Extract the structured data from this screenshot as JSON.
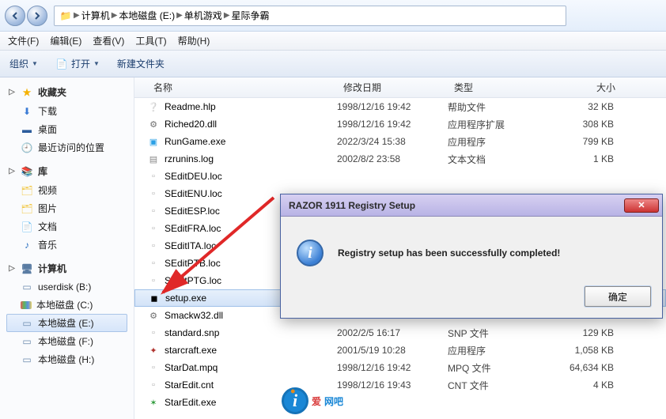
{
  "address": {
    "root_icon": "📁",
    "crumbs": [
      "计算机",
      "本地磁盘 (E:)",
      "单机游戏",
      "星际争霸"
    ]
  },
  "menus": [
    "文件(F)",
    "编辑(E)",
    "查看(V)",
    "工具(T)",
    "帮助(H)"
  ],
  "commands": {
    "organize": "组织",
    "open": "打开",
    "open_icon": "📄",
    "newfolder": "新建文件夹"
  },
  "sidebar": {
    "fav": {
      "label": "收藏夹",
      "icon": "★",
      "items": [
        {
          "label": "下载",
          "icon": "⬇",
          "cls": "ico-dl"
        },
        {
          "label": "桌面",
          "icon": "▬",
          "cls": "ico-desk"
        },
        {
          "label": "最近访问的位置",
          "icon": "🕘",
          "cls": "ico-recent"
        }
      ]
    },
    "lib": {
      "label": "库",
      "icon": "📚",
      "items": [
        {
          "label": "视频",
          "icon": "🗂",
          "cls": "ico-folder"
        },
        {
          "label": "图片",
          "icon": "🗂",
          "cls": "ico-folder"
        },
        {
          "label": "文档",
          "icon": "📄",
          "cls": "ico-note"
        },
        {
          "label": "音乐",
          "icon": "♪",
          "cls": "ico-music"
        }
      ]
    },
    "pc": {
      "label": "计算机",
      "icon": "🖥",
      "items": [
        {
          "label": "userdisk (B:)",
          "icon": "▭",
          "cls": "ico-drive"
        },
        {
          "label": "本地磁盘 (C:)",
          "icon": "",
          "cls": "ico-driveC"
        },
        {
          "label": "本地磁盘 (E:)",
          "icon": "▭",
          "cls": "ico-drive",
          "selected": true
        },
        {
          "label": "本地磁盘 (F:)",
          "icon": "▭",
          "cls": "ico-drive"
        },
        {
          "label": "本地磁盘 (H:)",
          "icon": "▭",
          "cls": "ico-drive"
        }
      ]
    }
  },
  "columns": {
    "name": "名称",
    "date": "修改日期",
    "type": "类型",
    "size": "大小"
  },
  "files": [
    {
      "icon": "❔",
      "c": "#3a7bd5",
      "name": "Readme.hlp",
      "date": "1998/12/16 19:42",
      "type": "帮助文件",
      "size": "32 KB"
    },
    {
      "icon": "⚙",
      "c": "#6e6e6e",
      "name": "Riched20.dll",
      "date": "1998/12/16 19:42",
      "type": "应用程序扩展",
      "size": "308 KB"
    },
    {
      "icon": "▣",
      "c": "#2aa0e6",
      "name": "RunGame.exe",
      "date": "2022/3/24 15:38",
      "type": "应用程序",
      "size": "799 KB"
    },
    {
      "icon": "▤",
      "c": "#888",
      "name": "rzrunins.log",
      "date": "2002/8/2 23:58",
      "type": "文本文档",
      "size": "1 KB"
    },
    {
      "icon": "▫",
      "c": "#aaa",
      "name": "SEditDEU.loc",
      "date": "",
      "type": "",
      "size": ""
    },
    {
      "icon": "▫",
      "c": "#aaa",
      "name": "SEditENU.loc",
      "date": "",
      "type": "",
      "size": ""
    },
    {
      "icon": "▫",
      "c": "#aaa",
      "name": "SEditESP.loc",
      "date": "",
      "type": "",
      "size": ""
    },
    {
      "icon": "▫",
      "c": "#aaa",
      "name": "SEditFRA.loc",
      "date": "",
      "type": "",
      "size": ""
    },
    {
      "icon": "▫",
      "c": "#aaa",
      "name": "SEditITA.loc",
      "date": "",
      "type": "",
      "size": ""
    },
    {
      "icon": "▫",
      "c": "#aaa",
      "name": "SEditPTB.loc",
      "date": "",
      "type": "",
      "size": ""
    },
    {
      "icon": "▫",
      "c": "#aaa",
      "name": "SEditPTG.loc",
      "date": "",
      "type": "",
      "size": ""
    },
    {
      "icon": "◼",
      "c": "#000",
      "name": "setup.exe",
      "date": "",
      "type": "",
      "size": "",
      "selected": true
    },
    {
      "icon": "⚙",
      "c": "#6e6e6e",
      "name": "Smackw32.dll",
      "date": "",
      "type": "",
      "size": ""
    },
    {
      "icon": "▫",
      "c": "#aaa",
      "name": "standard.snp",
      "date": "2002/2/5 16:17",
      "type": "SNP 文件",
      "size": "129 KB"
    },
    {
      "icon": "✦",
      "c": "#b0332e",
      "name": "starcraft.exe",
      "date": "2001/5/19 10:28",
      "type": "应用程序",
      "size": "1,058 KB"
    },
    {
      "icon": "▫",
      "c": "#aaa",
      "name": "StarDat.mpq",
      "date": "1998/12/16 19:42",
      "type": "MPQ 文件",
      "size": "64,634 KB"
    },
    {
      "icon": "▫",
      "c": "#aaa",
      "name": "StarEdit.cnt",
      "date": "1998/12/16 19:43",
      "type": "CNT 文件",
      "size": "4 KB"
    },
    {
      "icon": "✶",
      "c": "#2d9a3a",
      "name": "StarEdit.exe",
      "date": "",
      "type": "",
      "size": ""
    }
  ],
  "dialog": {
    "title": "RAZOR 1911 Registry Setup",
    "message": "Registry setup has been successfully completed!",
    "ok": "确定"
  },
  "watermark": {
    "t1": "爱",
    "t2": "网吧"
  }
}
